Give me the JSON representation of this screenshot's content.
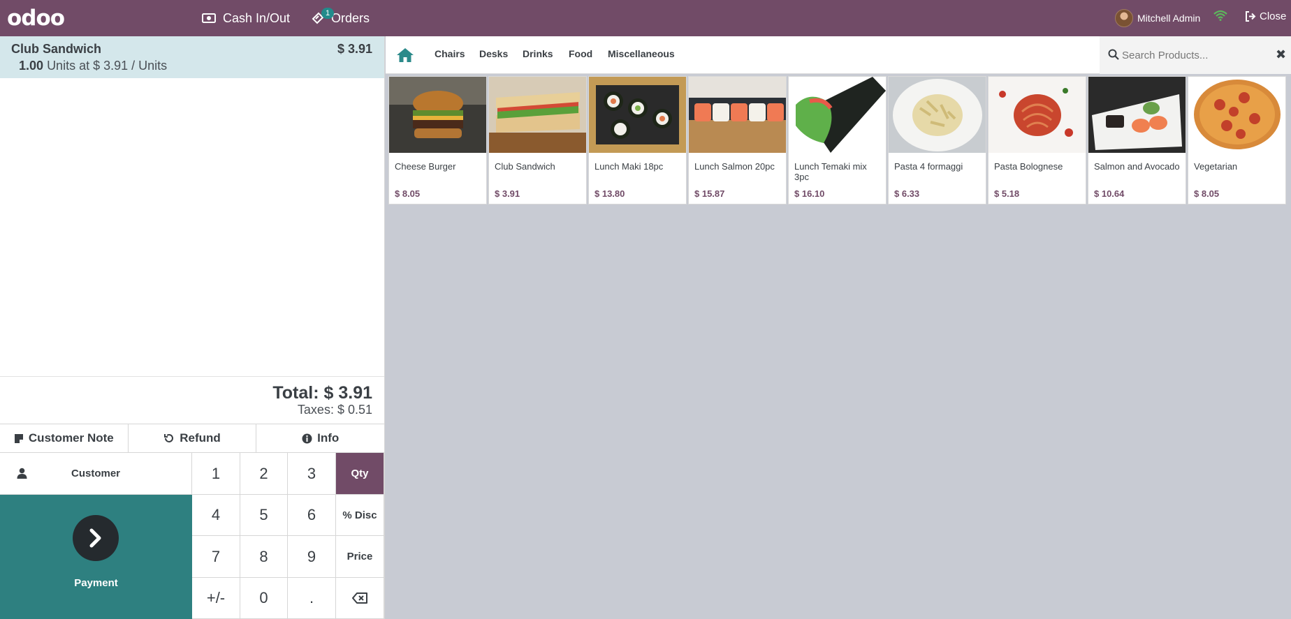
{
  "topbar": {
    "logo": "odoo",
    "cash_label": "Cash In/Out",
    "orders_label": "Orders",
    "orders_count": "1",
    "user_name": "Mitchell Admin",
    "close_label": "Close",
    "brand_color": "#714b67"
  },
  "order": {
    "lines": [
      {
        "name": "Club Sandwich",
        "price": "$ 3.91",
        "qty": "1.00",
        "detail": "Units at $ 3.91 / Units"
      }
    ],
    "total": "Total: $ 3.91",
    "taxes": "Taxes: $ 0.51"
  },
  "controls": {
    "customer_note": "Customer Note",
    "refund": "Refund",
    "info": "Info",
    "customer": "Customer",
    "payment": "Payment"
  },
  "numpad": {
    "keys": [
      "1",
      "2",
      "3",
      "Qty",
      "4",
      "5",
      "6",
      "% Disc",
      "7",
      "8",
      "9",
      "Price",
      "+/-",
      "0",
      ".",
      "⌫"
    ],
    "active_mode": "Qty"
  },
  "categories": [
    "Chairs",
    "Desks",
    "Drinks",
    "Food",
    "Miscellaneous"
  ],
  "search": {
    "placeholder": "Search Products..."
  },
  "products": [
    {
      "name": "Cheese Burger",
      "price": "$ 8.05"
    },
    {
      "name": "Club Sandwich",
      "price": "$ 3.91"
    },
    {
      "name": "Lunch Maki 18pc",
      "price": "$ 13.80"
    },
    {
      "name": "Lunch Salmon 20pc",
      "price": "$ 15.87"
    },
    {
      "name": "Lunch Temaki mix 3pc",
      "price": "$ 16.10"
    },
    {
      "name": "Pasta 4 formaggi",
      "price": "$ 6.33"
    },
    {
      "name": "Pasta Bolognese",
      "price": "$ 5.18"
    },
    {
      "name": "Salmon and Avocado",
      "price": "$ 10.64"
    },
    {
      "name": "Vegetarian",
      "price": "$ 8.05"
    }
  ]
}
